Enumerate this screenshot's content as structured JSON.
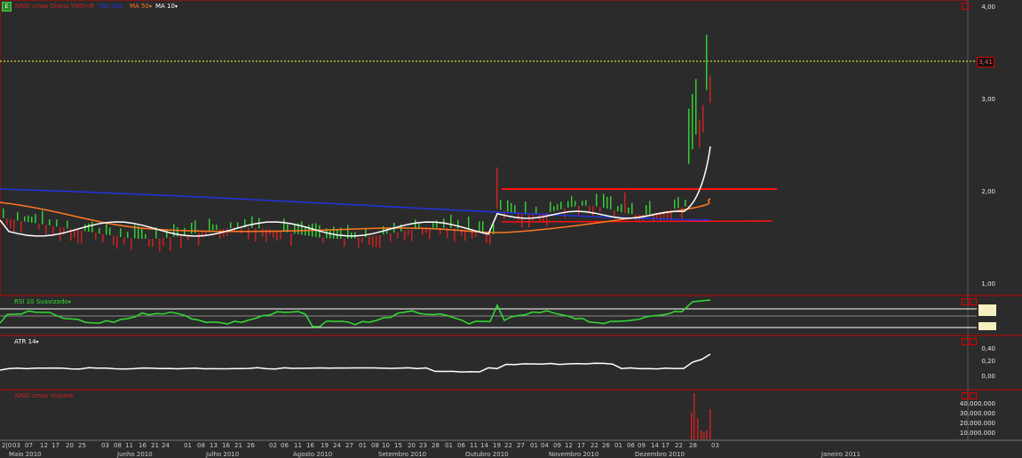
{
  "main": {
    "title": "XINO cmas Diario YMG=R",
    "indicator_blue": "MA 200",
    "indicator_orange": "MA 50",
    "indicator_white": "MA 10",
    "last_price": "3,41",
    "price_axis": [
      "4,00",
      "3,00",
      "2,00",
      "1,00"
    ],
    "colors": {
      "up": "#33cc33",
      "down": "#cc2222",
      "ma200": "#2233dd",
      "ma50": "#ff7722",
      "ma10": "#ffffff",
      "resist": "#ff1111"
    }
  },
  "rsi": {
    "label": "RSI 10 Suavizado"
  },
  "atr": {
    "label": "ATR 14",
    "axis": [
      "0,40",
      "0,20",
      "0,00"
    ]
  },
  "volume": {
    "label": "XINO cmas Volume",
    "axis": [
      "40.000.000",
      "30.000.000",
      "20.000.000",
      "10.000.000"
    ]
  },
  "date_axis": {
    "days": [
      "2|0",
      "03",
      "07",
      "12",
      "17",
      "20",
      "25",
      "03",
      "08",
      "11",
      "16",
      "21",
      "24",
      "01",
      "08",
      "13",
      "16",
      "21",
      "26",
      "02",
      "06",
      "11",
      "16",
      "19",
      "24",
      "27",
      "01",
      "08",
      "10",
      "15",
      "20",
      "23",
      "28",
      "01",
      "06",
      "11",
      "14",
      "19",
      "22",
      "27",
      "01",
      "04",
      "09",
      "12",
      "17",
      "22",
      "26",
      "01",
      "06",
      "09",
      "14",
      "17",
      "22",
      "28",
      "03"
    ],
    "months": [
      "Maio 2010",
      "Junho 2010",
      "Julho 2010",
      "Agosto 2010",
      "Setembro 2010",
      "Outubro 2010",
      "Novembro 2010",
      "Dezembro 2010",
      "Janeiro 2011"
    ]
  }
}
